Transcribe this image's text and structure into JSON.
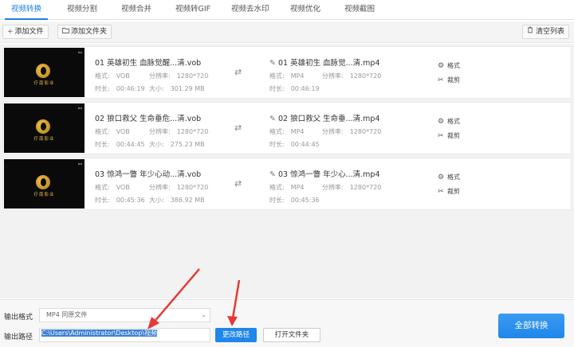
{
  "tabs": [
    {
      "label": "视频转换",
      "active": true
    },
    {
      "label": "视频分割"
    },
    {
      "label": "视频合并"
    },
    {
      "label": "视频转GIF"
    },
    {
      "label": "视频去水印"
    },
    {
      "label": "视频优化"
    },
    {
      "label": "视频截图"
    }
  ],
  "toolbar": {
    "add_file": "添加文件",
    "add_folder": "添加文件夹",
    "clear_list": "清空列表"
  },
  "thumbnail": {
    "logo_text": "疗南影业"
  },
  "labels": {
    "format": "格式:",
    "resolution": "分辨率:",
    "duration": "时长:",
    "size": "大小:",
    "format_action": "格式",
    "cut_action": "裁剪"
  },
  "files": [
    {
      "src_name": "01 英雄初生 血脉觉醒...清.vob",
      "src_format": "VOB",
      "src_resolution": "1280*720",
      "src_duration": "00:46:19",
      "src_size": "301.29 MB",
      "dst_name": "01 英雄初生 血脉觉...清.mp4",
      "dst_format": "MP4",
      "dst_resolution": "1280*720",
      "dst_duration": "00:46:19"
    },
    {
      "src_name": "02 狼口救父 生命垂危...清.vob",
      "src_format": "VOB",
      "src_resolution": "1280*720",
      "src_duration": "00:44:45",
      "src_size": "275.23 MB",
      "dst_name": "02 狼口救父 生命垂...清.mp4",
      "dst_format": "MP4",
      "dst_resolution": "1280*720",
      "dst_duration": "00:44:45"
    },
    {
      "src_name": "03 惊鸿一瞥 年少心动...清.vob",
      "src_format": "VOB",
      "src_resolution": "1280*720",
      "src_duration": "00:45:36",
      "src_size": "386.92 MB",
      "dst_name": "03 惊鸿一瞥 年少心...清.mp4",
      "dst_format": "MP4",
      "dst_resolution": "1280*720",
      "dst_duration": "00:45:36"
    }
  ],
  "output": {
    "format_label": "输出格式",
    "format_value": "MP4 同原文件",
    "path_label": "输出路径",
    "path_value": "C:\\Users\\Administrator\\Desktop\\视频",
    "change_path": "更改路径",
    "open_folder": "打开文件夹",
    "convert_all": "全部转换"
  },
  "colors": {
    "accent": "#1f86ea",
    "annotation_arrow": "#e53935"
  }
}
